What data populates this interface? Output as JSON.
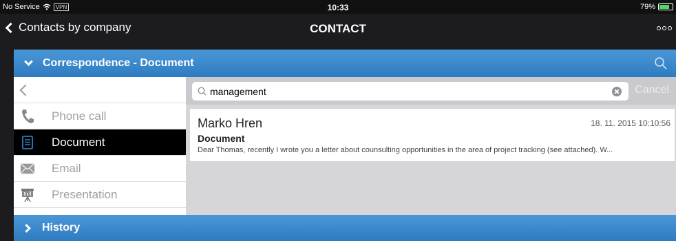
{
  "status": {
    "carrier": "No Service",
    "vpn": "VPN",
    "time": "10:33",
    "battery": "79%",
    "battery_level": 0.79
  },
  "nav": {
    "back_label": "Contacts by company",
    "title": "CONTACT"
  },
  "correspondence": {
    "header": "Correspondence - Document",
    "types": [
      {
        "label": "Phone call",
        "icon": "phone-icon"
      },
      {
        "label": "Document",
        "icon": "document-icon",
        "selected": true
      },
      {
        "label": "Email",
        "icon": "email-icon"
      },
      {
        "label": "Presentation",
        "icon": "presentation-icon"
      }
    ],
    "search": {
      "value": "management",
      "cancel_label": "Cancel"
    },
    "results": [
      {
        "name": "Marko Hren",
        "date": "18. 11. 2015 10:10:56",
        "type": "Document",
        "preview": "Dear Thomas, recently I wrote you a letter about counsulting opportunities in the area of project tracking (see attached). W..."
      }
    ]
  },
  "history": {
    "header": "History"
  },
  "colors": {
    "accent": "#3a8ad0",
    "selected_bg": "#000000",
    "battery": "#4cd964"
  }
}
